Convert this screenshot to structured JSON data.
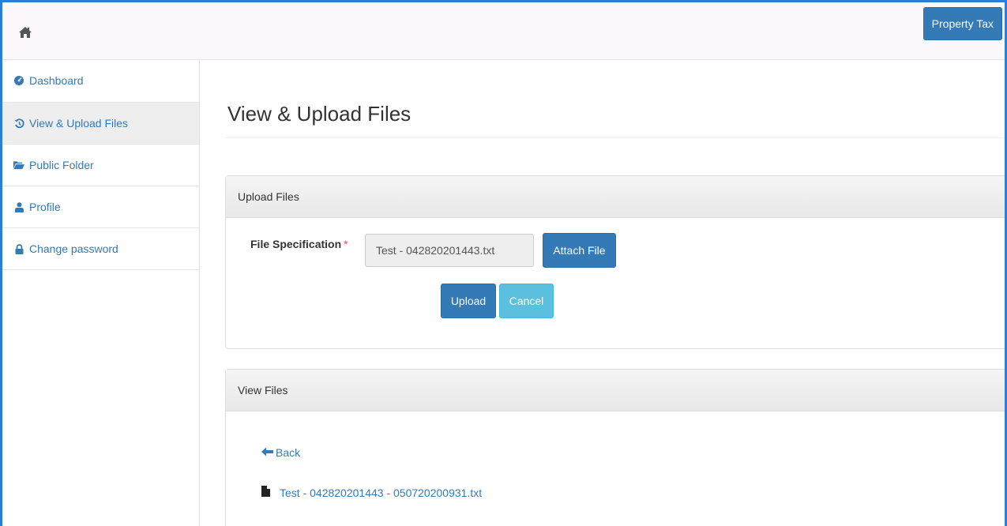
{
  "header": {
    "home_icon": "home-icon",
    "property_tax_label": "Property Tax"
  },
  "sidebar": {
    "items": [
      {
        "label": "Dashboard",
        "icon": "dashboard-icon"
      },
      {
        "label": "View & Upload Files",
        "icon": "history-icon",
        "active": true
      },
      {
        "label": "Public Folder",
        "icon": "folder-open-icon"
      },
      {
        "label": "Profile",
        "icon": "user-icon"
      },
      {
        "label": "Change password",
        "icon": "lock-icon"
      }
    ]
  },
  "main": {
    "page_title": "View & Upload Files",
    "upload_panel": {
      "heading": "Upload Files",
      "file_spec_label": "File Specification",
      "required_mark": "*",
      "file_value": "Test - 042820201443.txt",
      "attach_label": "Attach File",
      "upload_label": "Upload",
      "cancel_label": "Cancel"
    },
    "view_panel": {
      "heading": "View Files",
      "back_label": "Back",
      "files": [
        {
          "name": "Test - 042820201443 - 050720200931.txt",
          "icon": "file-icon"
        }
      ]
    }
  },
  "colors": {
    "primary": "#337ab7",
    "info": "#5bc0de",
    "frame_border": "#2a7fd4",
    "required": "#d9534f"
  }
}
